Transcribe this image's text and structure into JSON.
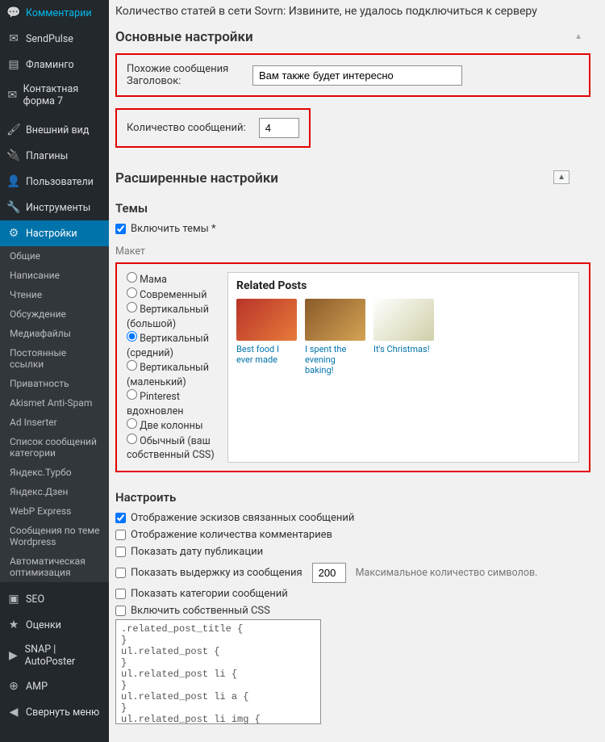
{
  "sidebar": {
    "items": [
      {
        "label": "Комментарии",
        "icon": "💬"
      },
      {
        "label": "SendPulse",
        "icon": "✉"
      },
      {
        "label": "Фламинго",
        "icon": "▤"
      },
      {
        "label": "Контактная форма 7",
        "icon": "✉"
      },
      {
        "label": "Внешний вид",
        "icon": "🖌"
      },
      {
        "label": "Плагины",
        "icon": "🔌"
      },
      {
        "label": "Пользователи",
        "icon": "👤"
      },
      {
        "label": "Инструменты",
        "icon": "🔧"
      },
      {
        "label": "Настройки",
        "icon": "⚙",
        "active": true
      }
    ],
    "subitems": [
      "Общие",
      "Написание",
      "Чтение",
      "Обсуждение",
      "Медиафайлы",
      "Постоянные ссылки",
      "Приватность",
      "Akismet Anti-Spam",
      "Ad Inserter",
      "Список сообщений категории",
      "Яндекс.Турбо",
      "Яндекс.Дзен",
      "WebP Express",
      "Сообщения по теме Wordpress",
      "Автоматическая оптимизация"
    ],
    "bottom": [
      {
        "label": "SEO",
        "icon": "▣"
      },
      {
        "label": "Оценки",
        "icon": "★"
      },
      {
        "label": "SNAP | AutoPoster",
        "icon": "▶"
      },
      {
        "label": "AMP",
        "icon": "⊕"
      },
      {
        "label": "Свернуть меню",
        "icon": "◀"
      }
    ]
  },
  "main": {
    "sovrn_note": "Количество статей в сети Sovrn: Извините, не удалось подключиться к серверу",
    "section_basic": "Основные настройки",
    "related_heading_label": "Похожие сообщения Заголовок:",
    "related_heading_value": "Вам также будет интересно",
    "count_label": "Количество сообщений:",
    "count_value": "4",
    "section_advanced": "Расширенные настройки",
    "themes_label": "Темы",
    "enable_themes": "Включить темы *",
    "layout_label": "Макет",
    "layout_options": [
      "Мама",
      "Современный",
      "Вертикальный (большой)",
      "Вертикальный (средний)",
      "Вертикальный (маленький)",
      "Pinterest вдохновлен",
      "Две колонны",
      "Обычный (ваш собственный CSS)"
    ],
    "layout_selected": 3,
    "preview": {
      "title": "Related Posts",
      "cards": [
        {
          "cap": "Best food I ever made"
        },
        {
          "cap": "I spent the evening baking!"
        },
        {
          "cap": "It's Christmas!"
        }
      ]
    },
    "customize_label": "Настроить",
    "custom_checks": [
      {
        "label": "Отображение эскизов связанных сообщений",
        "checked": true
      },
      {
        "label": "Отображение количества комментариев",
        "checked": false
      },
      {
        "label": "Показать дату публикации",
        "checked": false
      }
    ],
    "excerpt_label": "Показать выдержку из сообщения",
    "excerpt_value": "200",
    "excerpt_suffix": "Максимальное количество символов.",
    "custom_checks2": [
      {
        "label": "Показать категории сообщений",
        "checked": false
      },
      {
        "label": "Включить собственный CSS",
        "checked": false
      }
    ],
    "css_text": ".related_post_title {\n}\nul.related_post {\n}\nul.related_post li {\n}\nul.related_post li a {\n}\nul.related_post li img {\n}"
  }
}
